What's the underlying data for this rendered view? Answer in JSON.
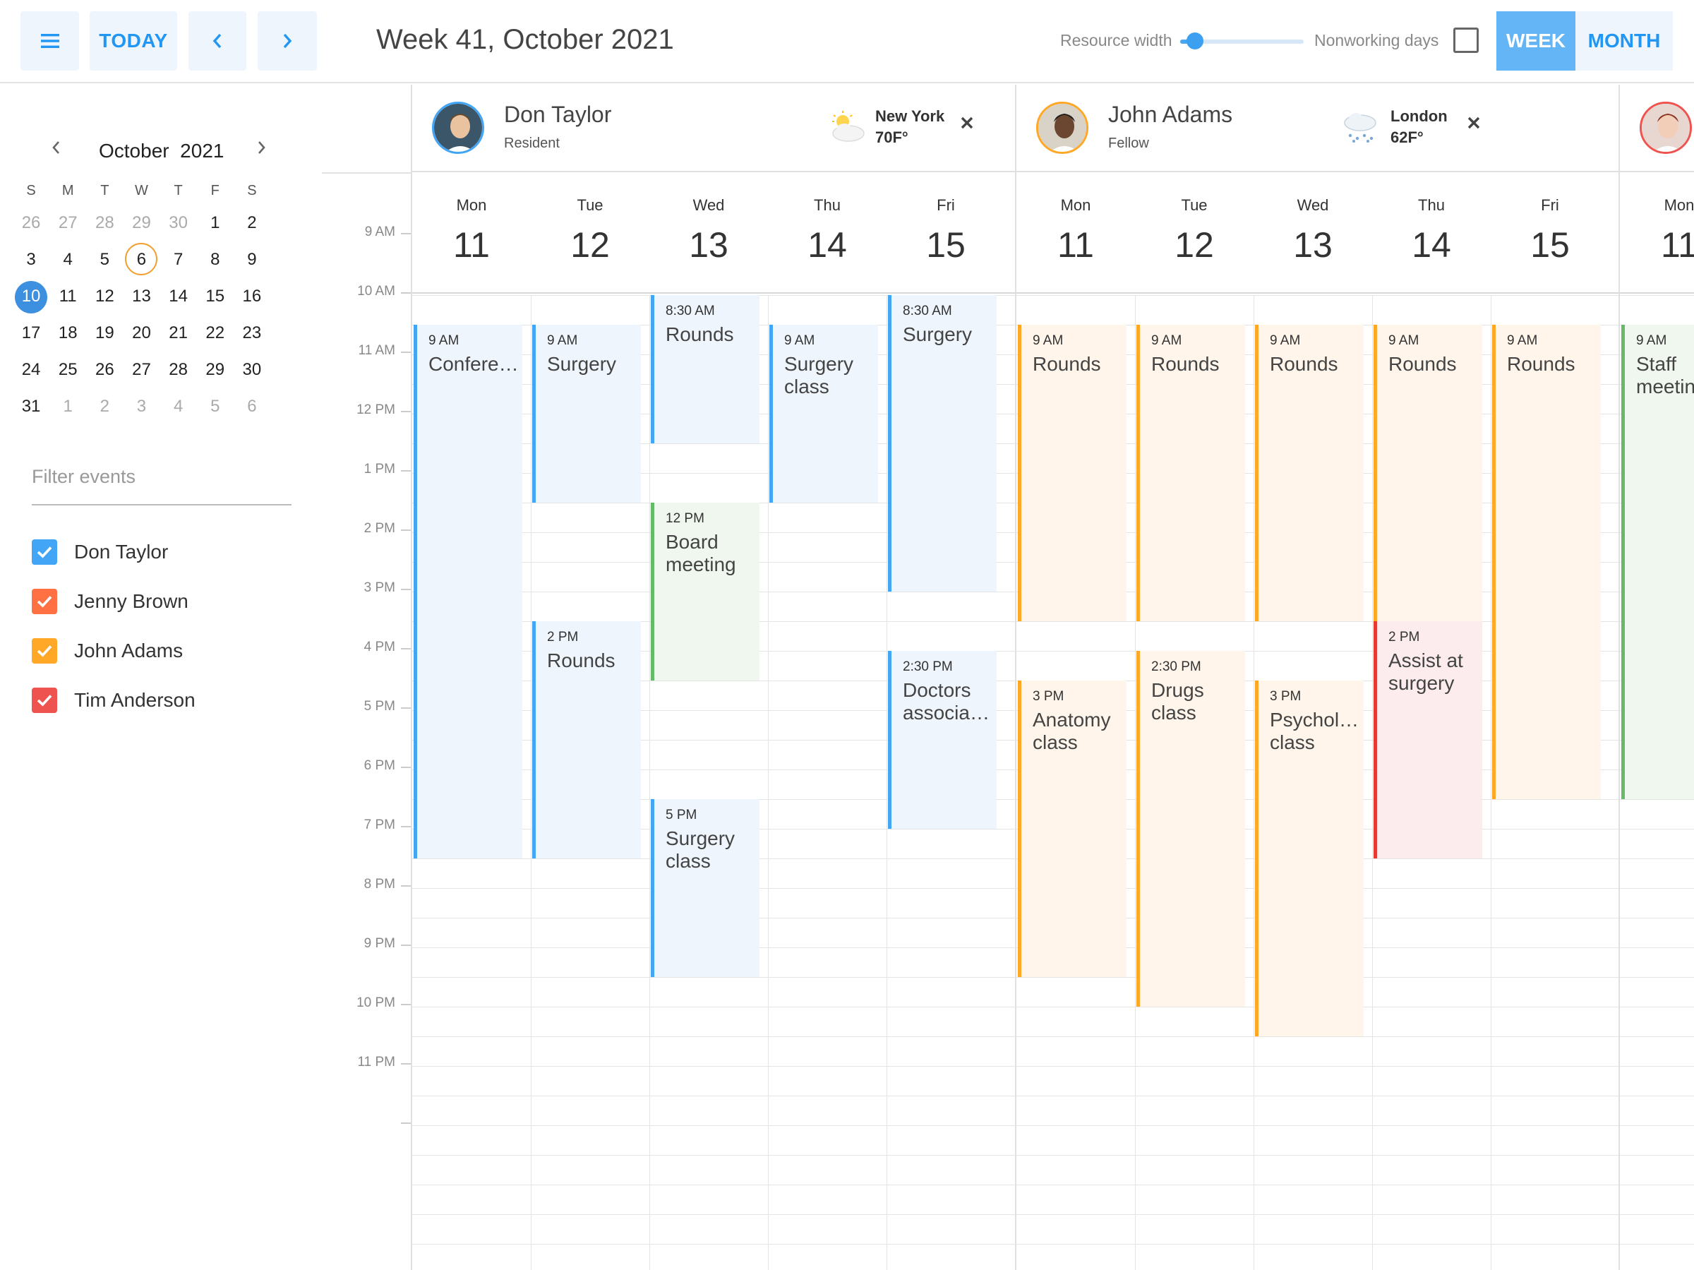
{
  "toolbar": {
    "today_label": "TODAY",
    "title": "Week 41, October 2021",
    "resource_width_label": "Resource width",
    "resource_width_value": 0.12,
    "nonworking_label": "Nonworking days",
    "nonworking_checked": false,
    "week_label": "WEEK",
    "month_label": "MONTH",
    "active_view": "WEEK",
    "accent": "#2196f3"
  },
  "mini_calendar": {
    "month": "October",
    "year": "2021",
    "weekday_headers": [
      "S",
      "M",
      "T",
      "W",
      "T",
      "F",
      "S"
    ],
    "weeks": [
      [
        {
          "d": "26",
          "o": true
        },
        {
          "d": "27",
          "o": true
        },
        {
          "d": "28",
          "o": true
        },
        {
          "d": "29",
          "o": true
        },
        {
          "d": "30",
          "o": true
        },
        {
          "d": "1"
        },
        {
          "d": "2"
        }
      ],
      [
        {
          "d": "3"
        },
        {
          "d": "4"
        },
        {
          "d": "5"
        },
        {
          "d": "6",
          "today": true
        },
        {
          "d": "7"
        },
        {
          "d": "8"
        },
        {
          "d": "9"
        }
      ],
      [
        {
          "d": "10",
          "sel": true
        },
        {
          "d": "11"
        },
        {
          "d": "12"
        },
        {
          "d": "13"
        },
        {
          "d": "14"
        },
        {
          "d": "15"
        },
        {
          "d": "16"
        }
      ],
      [
        {
          "d": "17"
        },
        {
          "d": "18"
        },
        {
          "d": "19"
        },
        {
          "d": "20"
        },
        {
          "d": "21"
        },
        {
          "d": "22"
        },
        {
          "d": "23"
        }
      ],
      [
        {
          "d": "24"
        },
        {
          "d": "25"
        },
        {
          "d": "26"
        },
        {
          "d": "27"
        },
        {
          "d": "28"
        },
        {
          "d": "29"
        },
        {
          "d": "30"
        }
      ],
      [
        {
          "d": "31"
        },
        {
          "d": "1",
          "o": true
        },
        {
          "d": "2",
          "o": true
        },
        {
          "d": "3",
          "o": true
        },
        {
          "d": "4",
          "o": true
        },
        {
          "d": "5",
          "o": true
        },
        {
          "d": "6",
          "o": true
        }
      ]
    ]
  },
  "filter": {
    "placeholder": "Filter events",
    "resources": [
      {
        "name": "Don Taylor",
        "color": "#42a5f5",
        "checked": true
      },
      {
        "name": "Jenny Brown",
        "color": "#ff7043",
        "checked": true
      },
      {
        "name": "John Adams",
        "color": "#ffa726",
        "checked": true
      },
      {
        "name": "Tim Anderson",
        "color": "#ef5350",
        "checked": true
      }
    ]
  },
  "time_labels": [
    "9 AM",
    "10 AM",
    "11 AM",
    "12 PM",
    "1 PM",
    "2 PM",
    "3 PM",
    "4 PM",
    "5 PM",
    "6 PM",
    "7 PM",
    "8 PM",
    "9 PM",
    "10 PM",
    "11 PM"
  ],
  "day_headers": [
    {
      "name": "Mon",
      "num": "11"
    },
    {
      "name": "Tue",
      "num": "12"
    },
    {
      "name": "Wed",
      "num": "13"
    },
    {
      "name": "Thu",
      "num": "14"
    },
    {
      "name": "Fri",
      "num": "15"
    }
  ],
  "resources": [
    {
      "name": "Don Taylor",
      "role": "Resident",
      "city": "New York",
      "temp": "70F°",
      "weather": "partly-sunny-icon",
      "color": "#42a5f5",
      "bg": "#eef5fd",
      "events": [
        {
          "day": 0,
          "start": 9,
          "end": 18,
          "time": "9 AM",
          "title": "Confere…"
        },
        {
          "day": 1,
          "start": 9,
          "end": 12,
          "time": "9 AM",
          "title": "Surgery"
        },
        {
          "day": 1,
          "start": 14,
          "end": 18,
          "time": "2 PM",
          "title": "Rounds"
        },
        {
          "day": 2,
          "start": 8.5,
          "end": 11,
          "time": "8:30 AM",
          "title": "Rounds"
        },
        {
          "day": 2,
          "start": 12,
          "end": 15,
          "time": "12 PM",
          "title": "Board meeting",
          "color": "#66bb6a",
          "bg": "#f0f7ee"
        },
        {
          "day": 2,
          "start": 17,
          "end": 20,
          "time": "5 PM",
          "title": "Surgery class"
        },
        {
          "day": 3,
          "start": 9,
          "end": 12,
          "time": "9 AM",
          "title": "Surgery class"
        },
        {
          "day": 4,
          "start": 8.5,
          "end": 13.5,
          "time": "8:30 AM",
          "title": "Surgery"
        },
        {
          "day": 4,
          "start": 14.5,
          "end": 17.5,
          "time": "2:30 PM",
          "title": "Doctors associa…"
        }
      ]
    },
    {
      "name": "John Adams",
      "role": "Fellow",
      "city": "London",
      "temp": "62F°",
      "weather": "snow-cloud-icon",
      "color": "#ffa726",
      "bg": "#fff5ea",
      "events": [
        {
          "day": 0,
          "start": 9,
          "end": 14,
          "time": "9 AM",
          "title": "Rounds"
        },
        {
          "day": 0,
          "start": 15,
          "end": 20,
          "time": "3 PM",
          "title": "Anatomy class"
        },
        {
          "day": 1,
          "start": 9,
          "end": 14,
          "time": "9 AM",
          "title": "Rounds"
        },
        {
          "day": 1,
          "start": 14.5,
          "end": 20.5,
          "time": "2:30 PM",
          "title": "Drugs class"
        },
        {
          "day": 2,
          "start": 9,
          "end": 14,
          "time": "9 AM",
          "title": "Rounds"
        },
        {
          "day": 2,
          "start": 15,
          "end": 21,
          "time": "3 PM",
          "title": "Psychol… class"
        },
        {
          "day": 3,
          "start": 9,
          "end": 14,
          "time": "9 AM",
          "title": "Rounds"
        },
        {
          "day": 3,
          "start": 14,
          "end": 18,
          "time": "2 PM",
          "title": "Assist at surgery",
          "color": "#e53935",
          "bg": "#fdeced"
        },
        {
          "day": 4,
          "start": 9,
          "end": 17,
          "time": "9 AM",
          "title": "Rounds"
        }
      ]
    },
    {
      "name": "",
      "role": "",
      "city": "",
      "temp": "",
      "weather": "",
      "color": "#66bb6a",
      "bg": "#f0f7ee",
      "events": [
        {
          "day": 0,
          "start": 9,
          "end": 17,
          "time": "9 AM",
          "title": "Staff meetin"
        }
      ],
      "partial_day": {
        "name": "Mon",
        "num": "11"
      }
    }
  ]
}
